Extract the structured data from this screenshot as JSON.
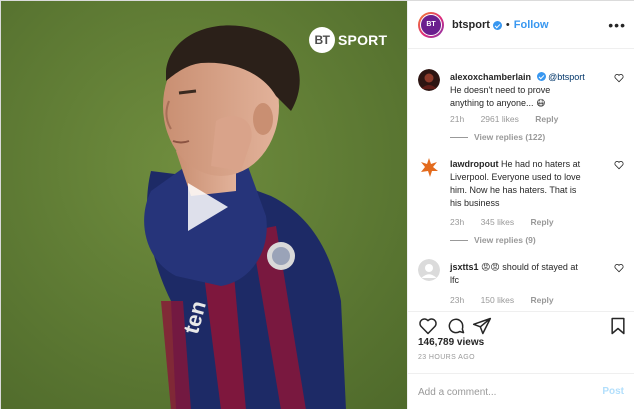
{
  "video": {
    "watermark_logo": "BT",
    "watermark_text": "SPORT",
    "play_icon": "play-icon"
  },
  "header": {
    "avatar_text": "BT",
    "username": "btsport",
    "separator": "•",
    "follow_label": "Follow",
    "more_icon": "more-options-icon"
  },
  "comments": [
    {
      "username": "alexoxchamberlain",
      "mention": "@btsport",
      "text_lines": [
        "He doesn't need to prove",
        "anything to anyone... 😷"
      ],
      "time": "21h",
      "likes": "2961 likes",
      "reply_label": "Reply",
      "view_replies": "View replies (122)"
    },
    {
      "username": "lawdropout",
      "text_lines": [
        "He had no haters at",
        "Liverpool. Everyone used to love",
        "him. Now he has haters. That is",
        "his business"
      ],
      "first_line_after_name": "He had no haters at",
      "time": "23h",
      "likes": "345 likes",
      "reply_label": "Reply",
      "view_replies": "View replies (9)"
    },
    {
      "username": "jsxtts1",
      "text_lines": [
        "😡😡 should of stayed at",
        "lfc"
      ],
      "time": "23h",
      "likes": "150 likes",
      "reply_label": "Reply"
    }
  ],
  "actions": {
    "like_icon": "heart-icon",
    "comment_icon": "comment-icon",
    "share_icon": "share-icon",
    "save_icon": "bookmark-icon"
  },
  "stats": {
    "views": "146,789 views",
    "ago": "23 HOURS AGO"
  },
  "add_comment": {
    "placeholder": "Add a comment...",
    "post_label": "Post"
  },
  "colors": {
    "link_blue": "#3897f0",
    "post_disabled": "#b2dffc",
    "pitch_green": "#5d7a33",
    "kit_blue": "#1d2a66",
    "kit_red": "#8a1538"
  }
}
